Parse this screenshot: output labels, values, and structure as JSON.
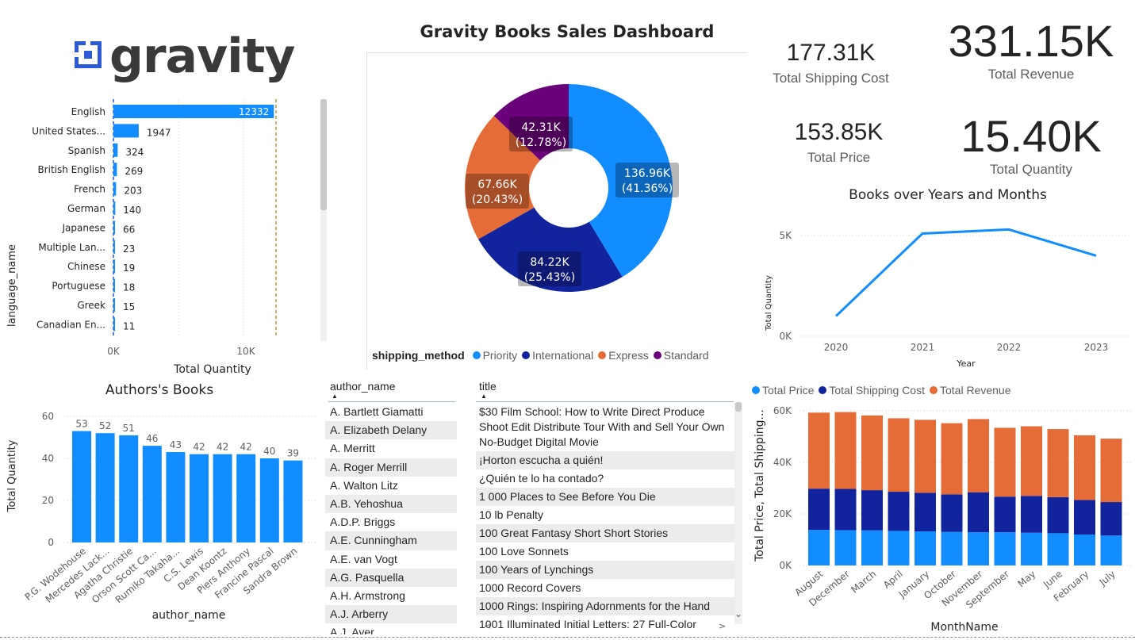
{
  "dashboard_title": "Gravity Books Sales Dashboard",
  "logo": {
    "text": "gravity",
    "color": "#3a3a3a",
    "mark_color": "#2d5bd6"
  },
  "colors": {
    "primary": "#118dff",
    "navy": "#12239e",
    "orange": "#e66c37",
    "purple": "#6b007b",
    "text": "#252423",
    "muted": "#605e5c",
    "gold": "#c8b36a"
  },
  "kpis": {
    "total_shipping_cost": {
      "value": "177.31K",
      "label": "Total Shipping Cost"
    },
    "total_revenue": {
      "value": "331.15K",
      "label": "Total Revenue"
    },
    "total_price": {
      "value": "153.85K",
      "label": "Total Price"
    },
    "total_quantity": {
      "value": "15.40K",
      "label": "Total Quantity"
    }
  },
  "language_chart": {
    "ylabel": "language_name",
    "xlabel": "Total Quantity",
    "tick_0": "0K",
    "tick_10k": "10K"
  },
  "donut": {
    "legend_title": "shipping_method"
  },
  "line_chart": {
    "title": "Books over Years and Months",
    "ylabel": "Total Quantity",
    "xlabel": "Year",
    "tick_5k": "5K",
    "tick_0": "0K"
  },
  "authors_chart": {
    "title": "Authors's Books",
    "ylabel": "Total Quantity",
    "xlabel": "author_name"
  },
  "stacked_chart": {
    "ylabel": "Total Price, Total Shipping...",
    "xlabel": "MonthName"
  },
  "author_table": {
    "header": "author_name",
    "rows": [
      "A. Bartlett Giamatti",
      "A. Elizabeth Delany",
      "A. Merritt",
      "A. Roger Merrill",
      "A. Walton Litz",
      "A.B. Yehoshua",
      "A.D.P. Briggs",
      "A.E. Cunningham",
      "A.E. van Vogt",
      "A.G. Pasquella",
      "A.H. Armstrong",
      "A.J. Arberry",
      "A.J. Ayer"
    ]
  },
  "title_table": {
    "header": "title",
    "rows": [
      "$30 Film School: How to Write Direct Produce Shoot Edit Distribute Tour With and Sell Your Own No-Budget Digital Movie",
      "¡Horton escucha a quién!",
      "¿Quién te lo ha contado?",
      "1 000 Places to See Before You Die",
      "10 lb Penalty",
      "100 Great Fantasy Short Short Stories",
      "100 Love Sonnets",
      "100 Years of Lynchings",
      "1000 Record Covers",
      "1000 Rings: Inspiring Adornments for the Hand",
      "1001 Illuminated Initial Letters: 27 Full-Color"
    ]
  },
  "chart_data": [
    {
      "type": "bar",
      "orientation": "horizontal",
      "categories": [
        "English",
        "United States...",
        "Spanish",
        "British English",
        "French",
        "German",
        "Japanese",
        "Multiple Lan...",
        "Chinese",
        "Portuguese",
        "Greek",
        "Canadian En..."
      ],
      "values": [
        12332,
        1947,
        324,
        269,
        203,
        140,
        66,
        23,
        19,
        18,
        15,
        11
      ],
      "xlabel": "Total Quantity",
      "ylabel": "language_name",
      "xlim": [
        0,
        12500
      ],
      "grid": true
    },
    {
      "type": "pie",
      "donut": true,
      "legend_title": "shipping_method",
      "legend_position": "bottom",
      "categories": [
        "Priority",
        "International",
        "Express",
        "Standard"
      ],
      "values": [
        136.96,
        84.22,
        67.66,
        42.31
      ],
      "value_labels": [
        "136.96K",
        "84.22K",
        "67.66K",
        "42.31K"
      ],
      "percent_labels": [
        "(41.36%)",
        "(25.43%)",
        "(20.43%)",
        "(12.78%)"
      ],
      "colors": [
        "#118dff",
        "#12239e",
        "#e66c37",
        "#6b007b"
      ]
    },
    {
      "type": "line",
      "title": "Books over Years and Months",
      "x": [
        "2020",
        "2021",
        "2022",
        "2023"
      ],
      "values": [
        1000,
        5100,
        5300,
        4000
      ],
      "xlabel": "Year",
      "ylabel": "Total Quantity",
      "ylim": [
        0,
        5500
      ],
      "grid": true
    },
    {
      "type": "bar",
      "title": "Authors's Books",
      "categories": [
        "P.G. Wodehouse",
        "Mercedes Lack...",
        "Agatha Christie",
        "Orson Scott Ca...",
        "Rumiko Takaha...",
        "C.S. Lewis",
        "Dean Koontz",
        "Piers Anthony",
        "Francine Pascal",
        "Sandra Brown"
      ],
      "values": [
        53,
        52,
        51,
        46,
        43,
        42,
        42,
        42,
        40,
        39
      ],
      "xlabel": "author_name",
      "ylabel": "Total Quantity",
      "ylim": [
        0,
        60
      ],
      "yticks": [
        "0",
        "20",
        "40",
        "60"
      ],
      "grid": true
    },
    {
      "type": "bar",
      "stacked": true,
      "categories": [
        "August",
        "December",
        "March",
        "April",
        "January",
        "October",
        "November",
        "September",
        "May",
        "June",
        "February",
        "July"
      ],
      "series": [
        {
          "name": "Total Price",
          "color": "#118dff",
          "values": [
            13.8,
            13.7,
            13.6,
            13.4,
            13.2,
            13.0,
            12.9,
            12.9,
            12.7,
            12.5,
            12.0,
            11.6
          ]
        },
        {
          "name": "Total Shipping Cost",
          "color": "#12239e",
          "values": [
            16.0,
            16.0,
            15.6,
            15.2,
            15.0,
            14.6,
            15.5,
            13.8,
            14.3,
            14.0,
            13.4,
            13.0
          ]
        },
        {
          "name": "Total Revenue",
          "color": "#e66c37",
          "values": [
            29.5,
            29.8,
            29.0,
            28.5,
            28.3,
            27.6,
            28.4,
            26.7,
            27.0,
            26.4,
            25.1,
            24.6
          ]
        }
      ],
      "xlabel": "MonthName",
      "ylabel": "Total Price, Total Shipping...",
      "ylim": [
        0,
        60
      ],
      "yticks": [
        "0K",
        "20K",
        "40K",
        "60K"
      ],
      "legend_position": "top-left"
    }
  ]
}
